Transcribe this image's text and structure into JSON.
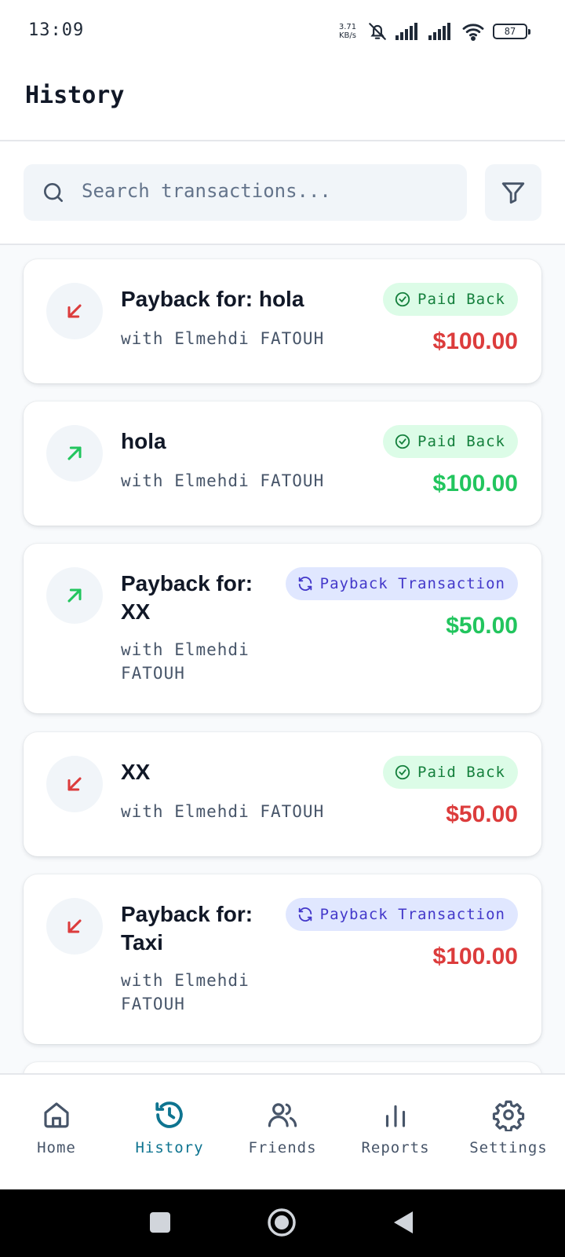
{
  "status_bar": {
    "time": "13:09",
    "net_speed_value": "3.71",
    "net_speed_unit": "KB/s",
    "battery": "87"
  },
  "header": {
    "title": "History"
  },
  "search": {
    "placeholder": "Search transactions..."
  },
  "transactions": [
    {
      "title": "Payback for: hola",
      "counterparty": "with Elmehdi FATOUH",
      "status": "Paid Back",
      "amount": "$100.00",
      "direction": "incoming",
      "amount_color": "#dc3c3c"
    },
    {
      "title": "hola",
      "counterparty": "with Elmehdi FATOUH",
      "status": "Paid Back",
      "amount": "$100.00",
      "direction": "outgoing",
      "amount_color": "#22c55e"
    },
    {
      "title": "Payback for: XX",
      "counterparty": "with Elmehdi FATOUH",
      "status": "Payback Transaction",
      "amount": "$50.00",
      "direction": "outgoing",
      "amount_color": "#22c55e"
    },
    {
      "title": "XX",
      "counterparty": "with Elmehdi FATOUH",
      "status": "Paid Back",
      "amount": "$50.00",
      "direction": "incoming",
      "amount_color": "#dc3c3c"
    },
    {
      "title": "Payback for: Taxi",
      "counterparty": "with Elmehdi FATOUH",
      "status": "Payback Transaction",
      "amount": "$100.00",
      "direction": "incoming",
      "amount_color": "#dc3c3c"
    }
  ],
  "bottom_nav": {
    "items": [
      {
        "label": "Home",
        "icon": "home-icon",
        "active": false
      },
      {
        "label": "History",
        "icon": "history-icon",
        "active": true
      },
      {
        "label": "Friends",
        "icon": "users-icon",
        "active": false
      },
      {
        "label": "Reports",
        "icon": "bar-chart-icon",
        "active": false
      },
      {
        "label": "Settings",
        "icon": "gear-icon",
        "active": false
      }
    ]
  },
  "colors": {
    "accent": "#0e7490",
    "negative": "#dc3c3c",
    "positive": "#22c55e",
    "paid_badge_bg": "#dcfce7",
    "payback_badge_bg": "#e0e7ff"
  }
}
